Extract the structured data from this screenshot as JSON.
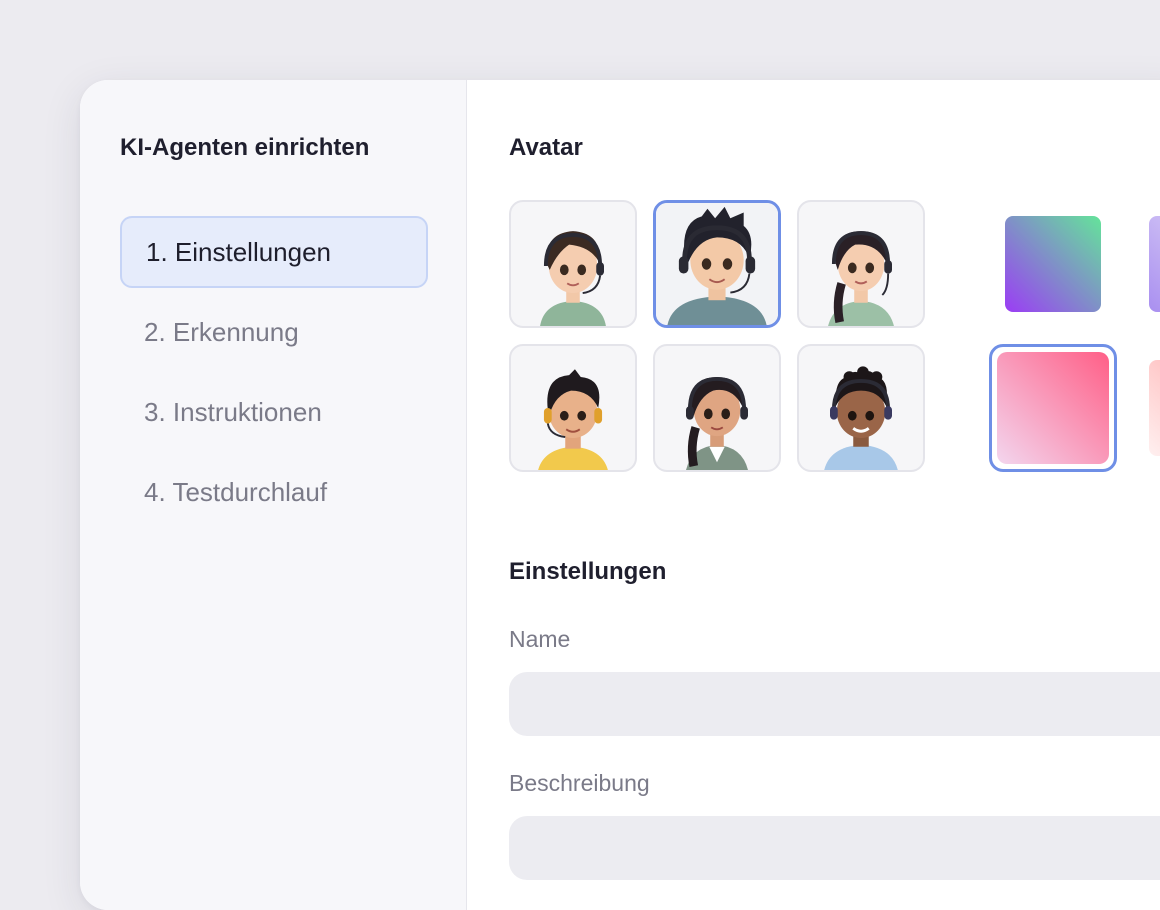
{
  "sidebar": {
    "title": "KI-Agenten einrichten",
    "steps": [
      {
        "label": "1. Einstellungen",
        "active": true
      },
      {
        "label": "2. Erkennung",
        "active": false
      },
      {
        "label": "3. Instruktionen",
        "active": false
      },
      {
        "label": "4. Testdurchlauf",
        "active": false
      }
    ]
  },
  "avatar_section": {
    "title": "Avatar",
    "avatars": [
      {
        "name": "avatar-girl-short-hair",
        "selected": false
      },
      {
        "name": "avatar-boy-spiky-hair",
        "selected": true
      },
      {
        "name": "avatar-girl-braid",
        "selected": false
      },
      {
        "name": "avatar-boy-yellow-shirt",
        "selected": false
      },
      {
        "name": "avatar-girl-braid-dark",
        "selected": false
      },
      {
        "name": "avatar-boy-curly-hair",
        "selected": false
      }
    ],
    "background_colors": [
      {
        "from": "#9b3cf5",
        "to": "#64e49a",
        "selected": false
      },
      {
        "from": "#a98ff0",
        "to": "#e3dcf7",
        "selected": false
      },
      {
        "from": "#ff5f87",
        "to": "#f3d6ee",
        "selected": true
      },
      {
        "from": "#ffa8a8",
        "to": "#fff0f0",
        "selected": false
      }
    ]
  },
  "settings_section": {
    "title": "Einstellungen",
    "name_label": "Name",
    "name_value": "",
    "description_label": "Beschreibung",
    "description_value": ""
  },
  "colors": {
    "accent": "#6f8fe6",
    "active_nav_bg": "#e6ecfb",
    "input_bg": "#ececf1"
  }
}
